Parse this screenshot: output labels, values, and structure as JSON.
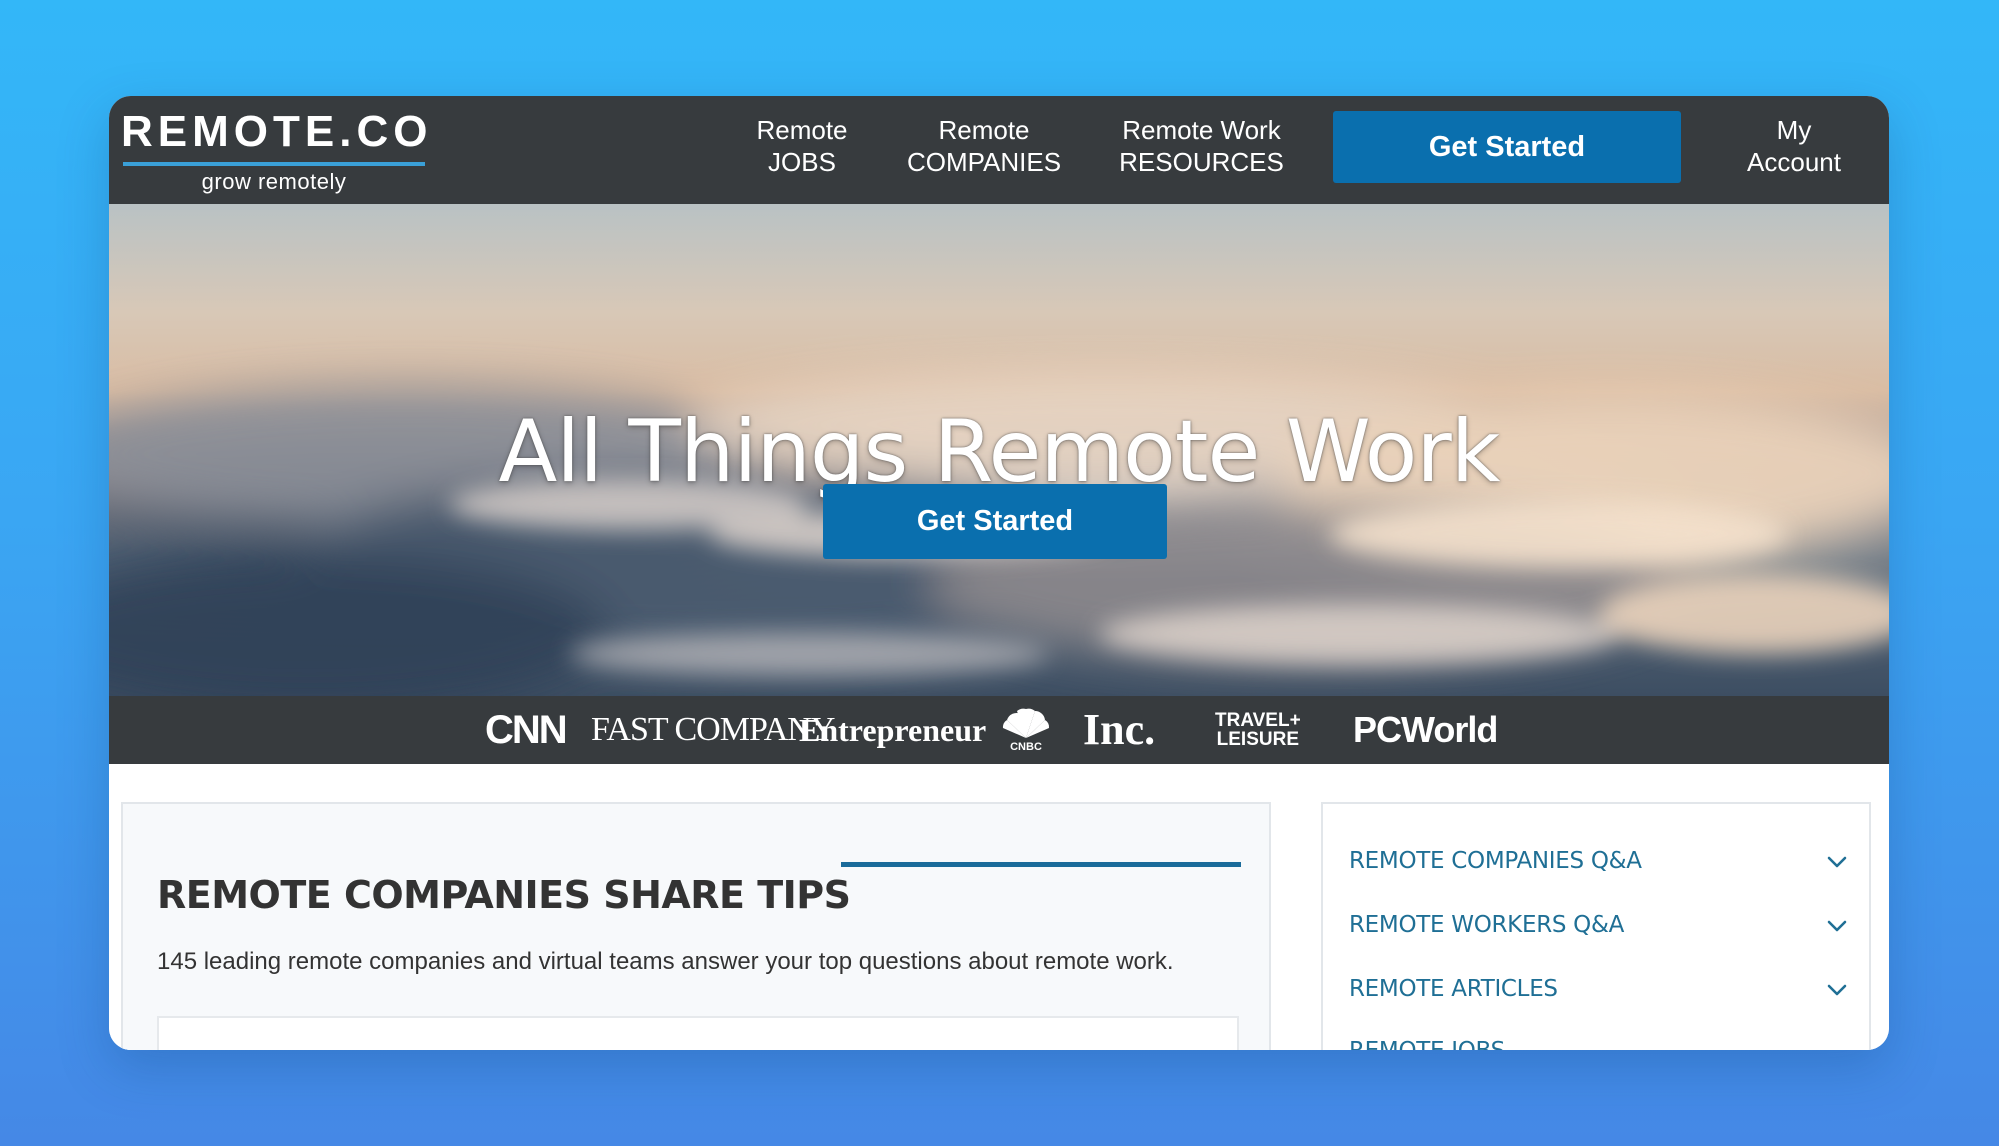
{
  "header": {
    "logo": {
      "name": "REMOTE.CO",
      "tagline": "grow remotely"
    },
    "nav": [
      {
        "line1": "Remote",
        "line2": "JOBS"
      },
      {
        "line1": "Remote",
        "line2": "COMPANIES"
      },
      {
        "line1": "Remote Work",
        "line2": "RESOURCES"
      }
    ],
    "cta_label": "Get Started",
    "account": {
      "line1": "My",
      "line2": "Account"
    }
  },
  "hero": {
    "title": "All Things Remote Work",
    "cta_label": "Get Started"
  },
  "press_logos": {
    "cnn": "CNN",
    "fastcompany": "FAST COMPANY",
    "entrepreneur": "Entrepreneur",
    "cnbc": "CNBC",
    "inc": "Inc.",
    "travel_line1": "TRAVEL+",
    "travel_line2": "LEISURE",
    "pcworld": "PCWorld"
  },
  "tips": {
    "title": "REMOTE COMPANIES SHARE TIPS",
    "description": "145 leading remote companies and virtual teams answer your top questions about remote work."
  },
  "sidebar": {
    "items": [
      {
        "label": "REMOTE COMPANIES Q&A"
      },
      {
        "label": "REMOTE WORKERS Q&A"
      },
      {
        "label": "REMOTE ARTICLES"
      },
      {
        "label": "REMOTE JOBS"
      }
    ]
  },
  "colors": {
    "background": "#3aa6f3",
    "header": "#373b3e",
    "accent_blue": "#0a6fae",
    "link_teal": "#1f6f95"
  }
}
